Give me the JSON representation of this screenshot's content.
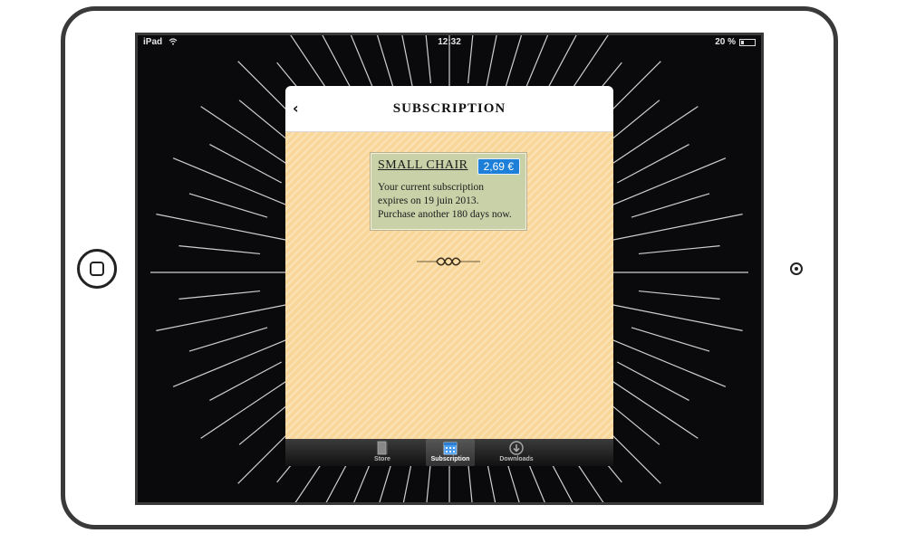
{
  "statusbar": {
    "carrier": "iPad",
    "time": "12:32",
    "battery": "20 %"
  },
  "modal": {
    "title": "SUBSCRIPTION",
    "back_icon": "chevron-left-icon"
  },
  "subscription": {
    "product_name": "SMALL CHAIR",
    "price": "2,69 €",
    "description": "Your current subscription\nexpires on 19 juin 2013.\nPurchase another 180 days now."
  },
  "tabbar": {
    "tabs": [
      {
        "label": "Store",
        "icon": "book-icon",
        "active": false
      },
      {
        "label": "Subscription",
        "icon": "calendar-icon",
        "active": true
      },
      {
        "label": "Downloads",
        "icon": "download-icon",
        "active": false
      }
    ]
  },
  "colors": {
    "accent": "#1d7fd8",
    "card": "#c9d1a9",
    "paper": "#f9d79a",
    "screen": "#0a0a0d"
  }
}
